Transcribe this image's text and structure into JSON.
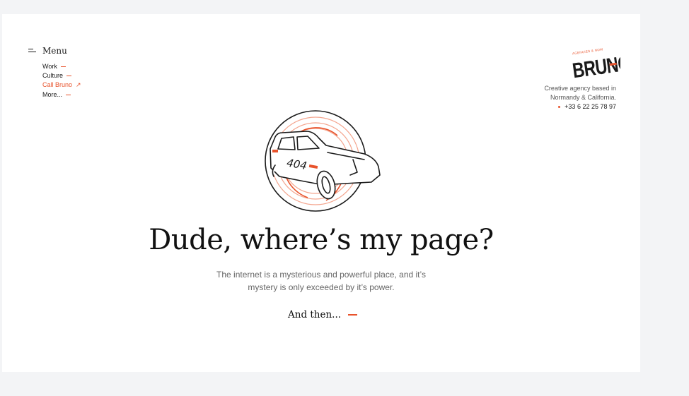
{
  "menu": {
    "label": "Menu",
    "items": [
      {
        "label": "Work"
      },
      {
        "label": "Culture"
      },
      {
        "label": "Call Bruno"
      },
      {
        "label": "More..."
      }
    ]
  },
  "logo": {
    "text": "BRUNO",
    "tagline": "AGENCIES & NOW"
  },
  "agency": {
    "line1": "Creative agency based in",
    "line2": "Normandy & California.",
    "phone": "+33 6 22 25 78 97"
  },
  "illustration": {
    "plate": "404"
  },
  "hero": {
    "headline": "Dude, where’s my page?",
    "subtext": "The internet is a mysterious and powerful place, and it’s mystery is only exceeded by it’s power.",
    "cta": "And then..."
  },
  "colors": {
    "accent": "#e8532c",
    "accent_light": "#f4a58e",
    "text": "#1a1a1a",
    "background": "#f3f4f6",
    "page": "#ffffff"
  }
}
